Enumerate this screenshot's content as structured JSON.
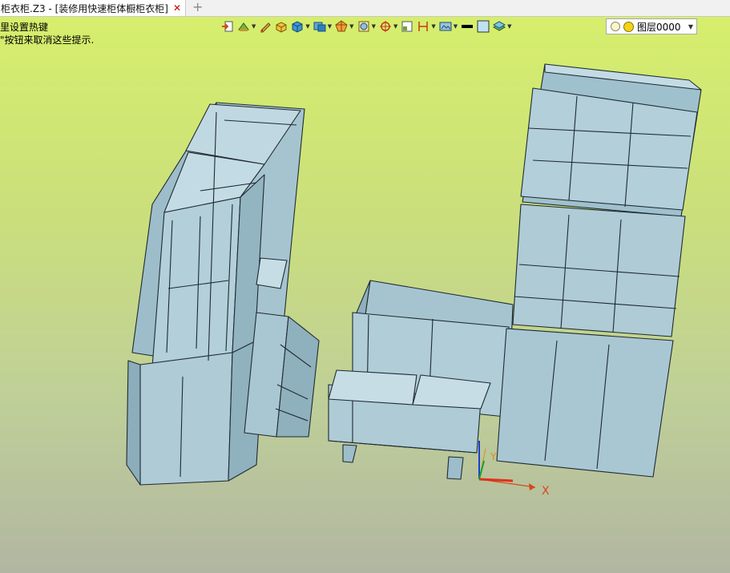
{
  "tab": {
    "title": "柜衣柜.Z3 - [装修用快速柜体橱柜衣柜]",
    "close": "✕"
  },
  "new_tab": "+",
  "hints": [
    "里设置热键",
    "\"按钮来取消这些提示."
  ],
  "toolbar": {
    "icons": [
      "exit-icon",
      "cabinet-tool-icon",
      "pencil-icon",
      "box-shade-icon",
      "cube-view-icon",
      "view-mode-icon",
      "render-mode-icon",
      "section-icon",
      "snap-icon",
      "small-frame-icon",
      "dimension-icon",
      "display-filter-icon",
      "line-style-icon",
      "color-box-icon",
      "layer-manager-icon"
    ],
    "layer": {
      "label": "图层0000"
    }
  },
  "axes": {
    "x": "X",
    "y": "Y"
  },
  "colors": {
    "cabinet": "#a9c7d3",
    "cabinet_dark": "#8fb0bd",
    "edge": "#1f2a30",
    "axis_x": "#d24a1b",
    "axis_y": "#d88a2a",
    "bg_top": "#d7f06b",
    "bg_bottom": "#b1b6a2"
  }
}
